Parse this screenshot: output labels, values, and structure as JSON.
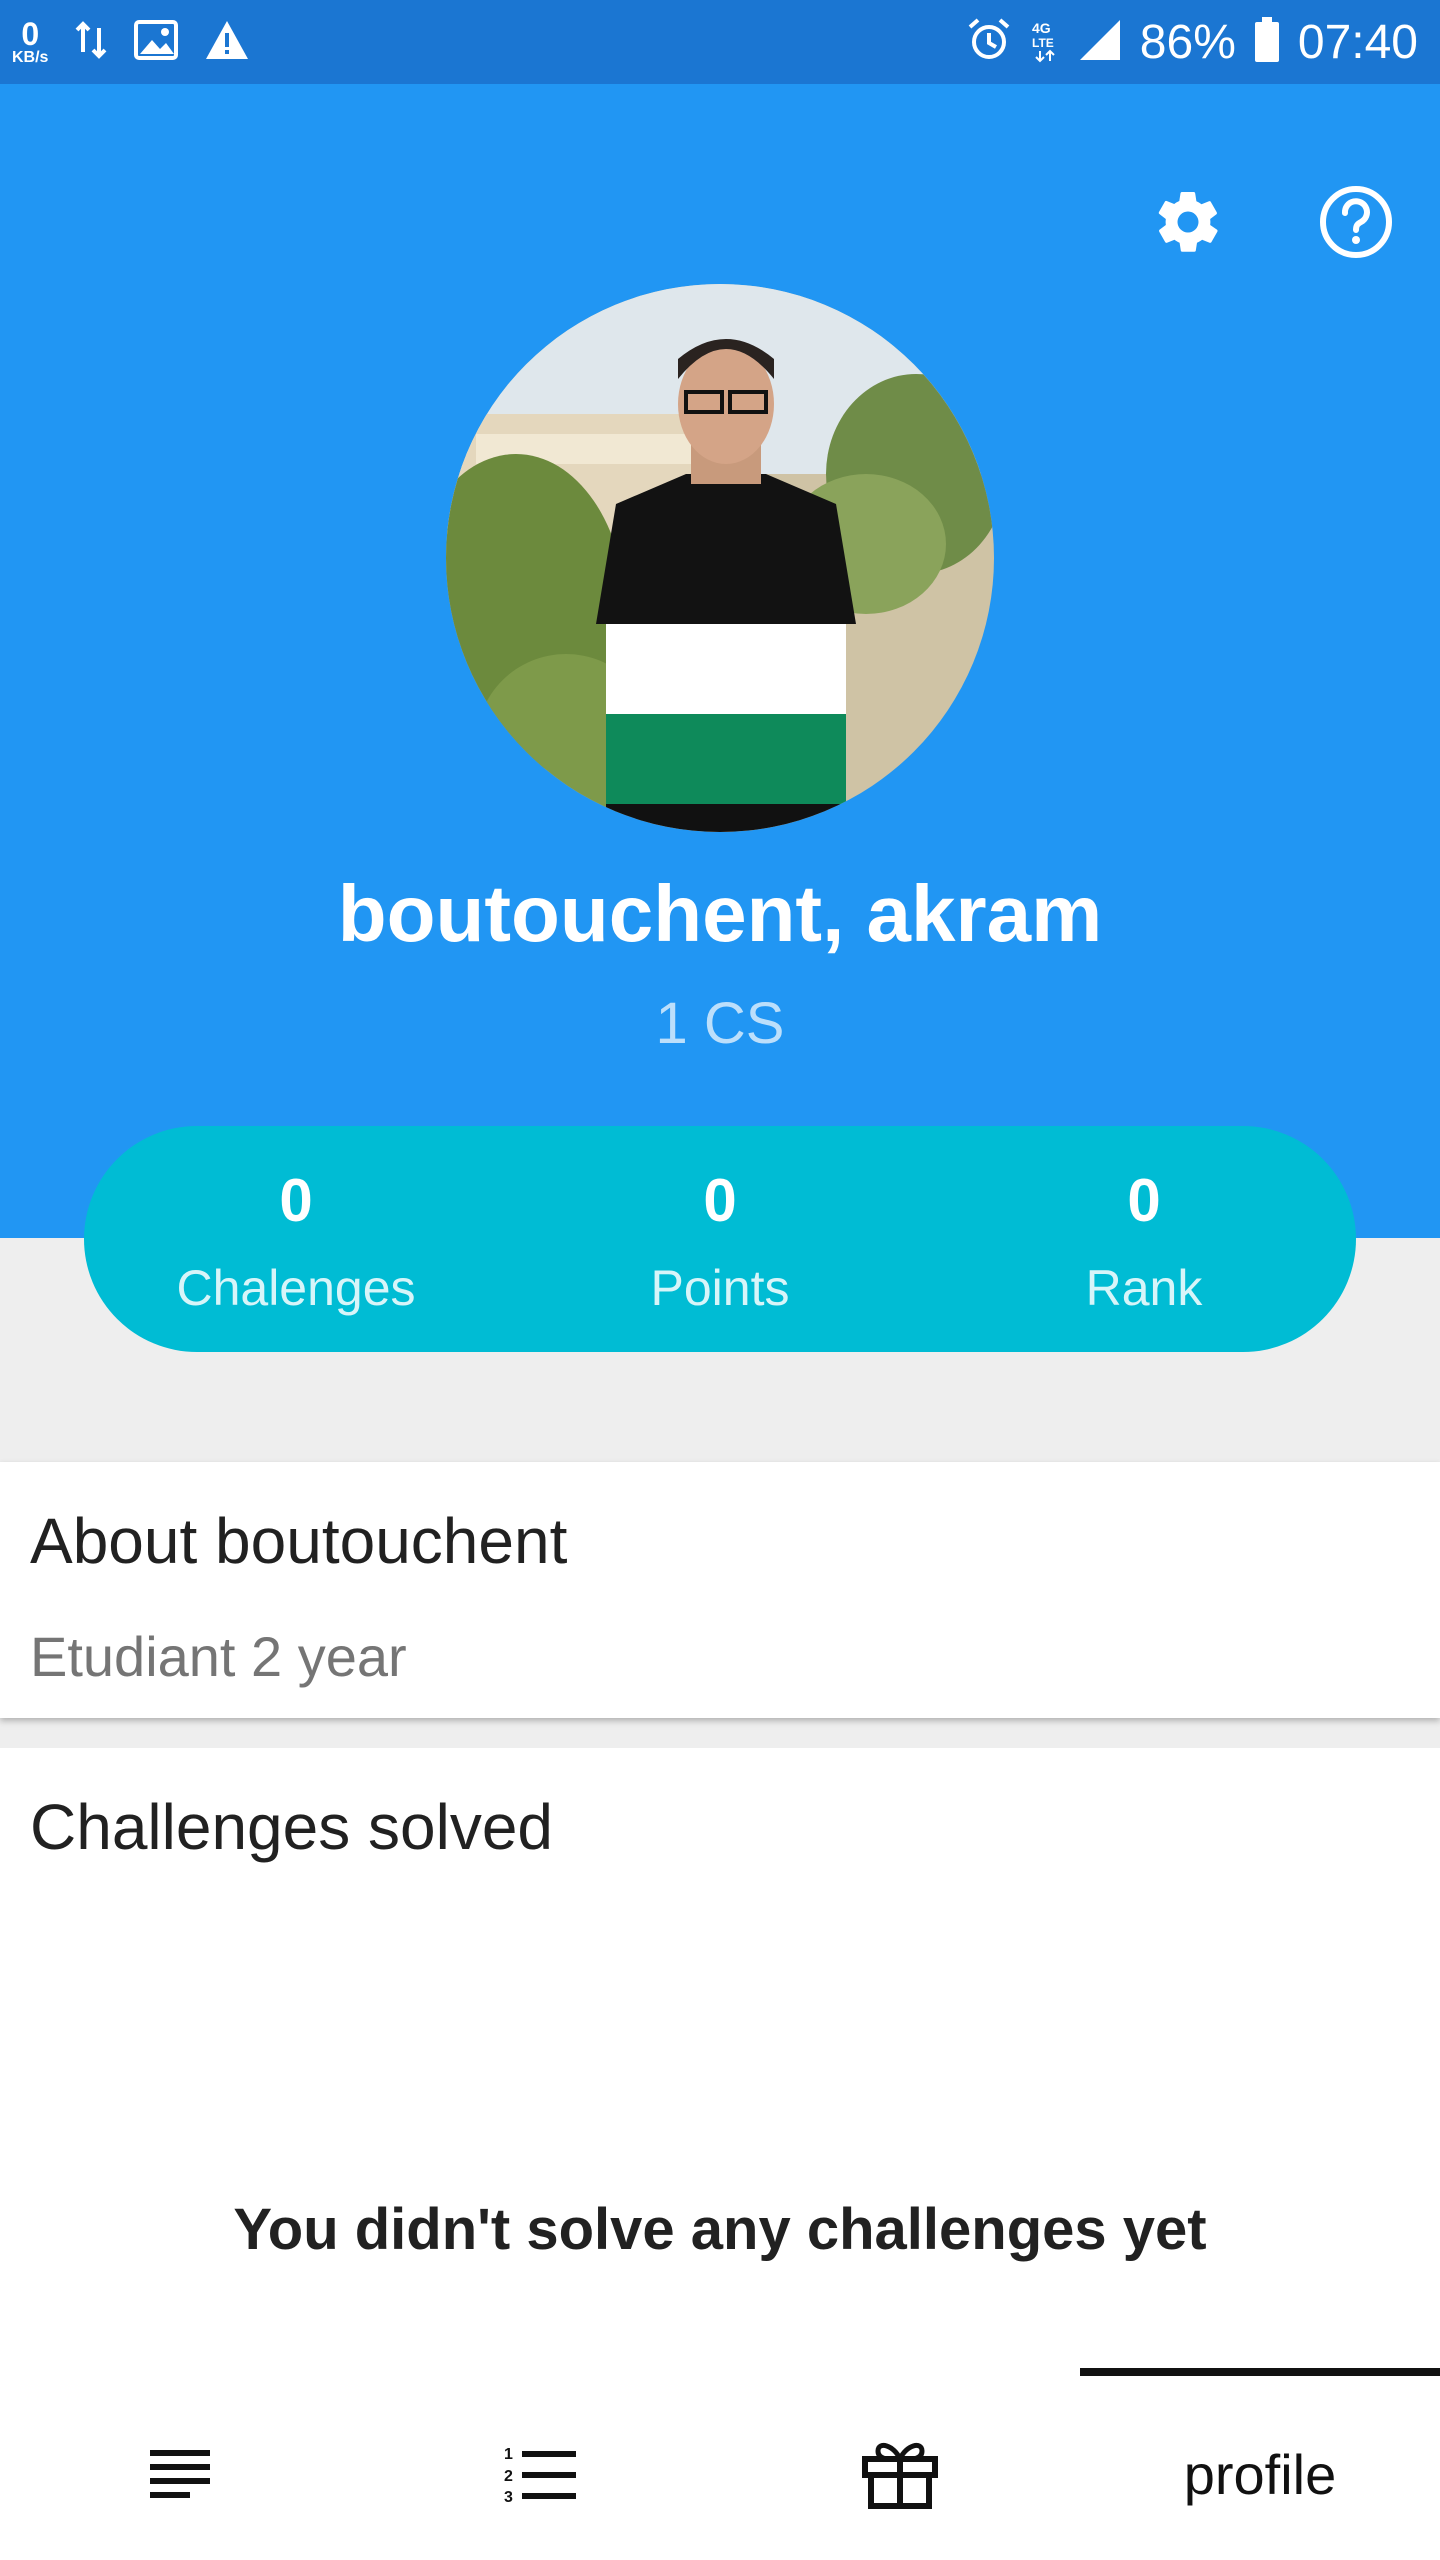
{
  "status_bar": {
    "net_speed_value": "0",
    "net_speed_unit": "KB/s",
    "battery": "86%",
    "time": "07:40",
    "left_icons": [
      "data-transfer-icon",
      "image-icon",
      "warning-icon"
    ],
    "right_icons": [
      "alarm-icon",
      "4g-lte-icon",
      "signal-icon",
      "battery-icon"
    ]
  },
  "header": {
    "settings_icon": "gear-icon",
    "help_icon": "help-circle-icon",
    "background_color": "#2196f3"
  },
  "profile": {
    "name": "boutouchent, akram",
    "department": "1 CS"
  },
  "stats": [
    {
      "value": "0",
      "label": "Chalenges"
    },
    {
      "value": "0",
      "label": "Points"
    },
    {
      "value": "0",
      "label": "Rank"
    }
  ],
  "about": {
    "title": "About boutouchent",
    "text": "Etudiant 2 year"
  },
  "challenges": {
    "title": "Challenges solved",
    "empty_message": "You didn't solve any challenges yet"
  },
  "bottom_nav": {
    "tabs": [
      {
        "icon": "feed-icon"
      },
      {
        "icon": "numbered-list-icon"
      },
      {
        "icon": "gift-icon"
      },
      {
        "label": "profile",
        "active": true
      }
    ]
  },
  "colors": {
    "status_bar": "#1b76d2",
    "stats_pill": "#00bcd4",
    "page_bg": "#eeeeee"
  }
}
